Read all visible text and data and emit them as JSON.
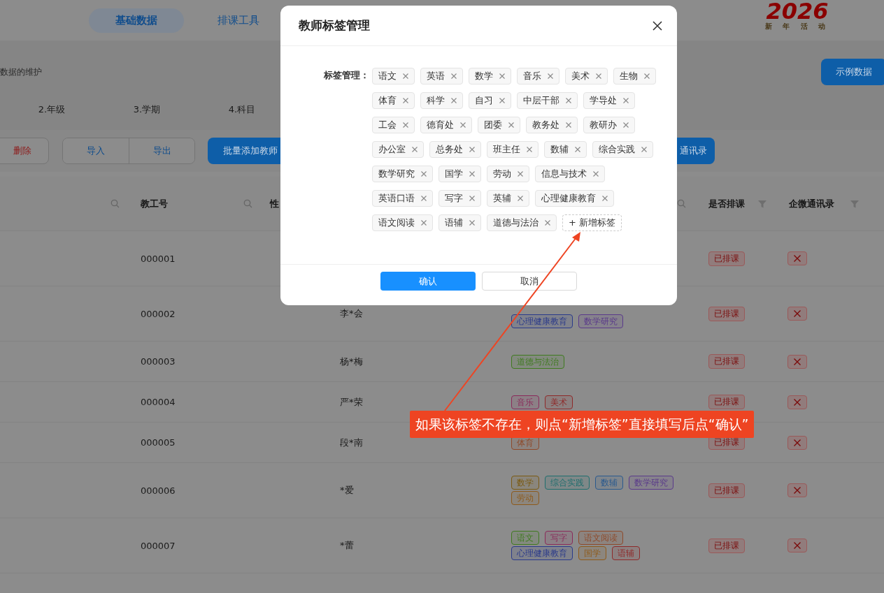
{
  "top_nav": {
    "tabs": [
      {
        "label": "基础数据",
        "selected": true
      },
      {
        "label": "排课工具",
        "selected": false
      }
    ],
    "logo": {
      "year": "2026",
      "caption": "新 年 活 动"
    }
  },
  "intro": {
    "description": "数据的维护",
    "sample_button": "示例数据",
    "steps": [
      "2.年级",
      "3.学期",
      "4.科目"
    ]
  },
  "toolbar": {
    "delete": "删除",
    "import": "导入",
    "export": "导出",
    "batch_add": "批量添加教师",
    "contacts": "通讯录"
  },
  "table": {
    "columns": [
      {
        "kind": "search"
      },
      {
        "label": "教工号",
        "kind": "search"
      },
      {
        "label": "性",
        "kind": "plain"
      },
      {
        "kind": "search"
      },
      {
        "label": "是否排课",
        "kind": "filter"
      },
      {
        "label": "企微通讯录",
        "kind": "filter"
      }
    ],
    "rows": [
      {
        "id": "000001",
        "scheduled": "已排课",
        "wecom": false
      },
      {
        "id": "000002",
        "name": "李*会",
        "tags": [
          {
            "label": "心理健康教育",
            "color": "#2a3a8a"
          },
          {
            "label": "数学研究",
            "color": "#5a3a8a"
          }
        ],
        "scheduled": "已排课",
        "wecom": false
      },
      {
        "id": "000003",
        "name": "杨*梅",
        "tags": [
          {
            "label": "道德与法治",
            "color": "#3f7a1f"
          }
        ],
        "scheduled": "已排课",
        "wecom": false
      },
      {
        "id": "000004",
        "name": "严*荣",
        "tags": [
          {
            "label": "音乐",
            "color": "#8a2a5a"
          },
          {
            "label": "美术",
            "color": "#8e2a2a"
          }
        ],
        "scheduled": "已排课",
        "wecom": false
      },
      {
        "id": "000005",
        "name": "段*南",
        "tags": [
          {
            "label": "体育",
            "color": "#8e4a2a"
          }
        ],
        "scheduled": "已排课",
        "wecom": false
      },
      {
        "id": "000006",
        "name": "*爱",
        "tags": [
          {
            "label": "数学",
            "color": "#7a5a12"
          },
          {
            "label": "综合实践",
            "color": "#1f6e6e"
          },
          {
            "label": "数辅",
            "color": "#2a5a8e"
          },
          {
            "label": "数学研究",
            "color": "#5a3a8a"
          },
          {
            "label": "劳动",
            "color": "#8e5a1a"
          }
        ],
        "scheduled": "已排课",
        "wecom": false
      },
      {
        "id": "000007",
        "name": "*蕾",
        "tags": [
          {
            "label": "语文",
            "color": "#3f7a1f"
          },
          {
            "label": "写字",
            "color": "#8a2a5a"
          },
          {
            "label": "语文阅读",
            "color": "#8e4a2a"
          },
          {
            "label": "心理健康教育",
            "color": "#2a3a8a"
          },
          {
            "label": "国学",
            "color": "#8e5a1a"
          },
          {
            "label": "语辅",
            "color": "#8e2a2a"
          }
        ],
        "scheduled": "已排课",
        "wecom": false
      }
    ]
  },
  "modal": {
    "title": "教师标签管理",
    "field_label": "标签管理：",
    "tags": [
      "语文",
      "英语",
      "数学",
      "音乐",
      "美术",
      "生物",
      "体育",
      "科学",
      "自习",
      "中层干部",
      "学导处",
      "工会",
      "德育处",
      "团委",
      "教务处",
      "教研办",
      "办公室",
      "总务处",
      "班主任",
      "数辅",
      "综合实践",
      "数学研究",
      "国学",
      "劳动",
      "信息与技术",
      "英语口语",
      "写字",
      "英辅",
      "心理健康教育",
      "语文阅读",
      "语辅",
      "道德与法治"
    ],
    "add_tag": "新增标签",
    "add_icon": "+",
    "confirm": "确认",
    "cancel": "取消"
  },
  "annotation": {
    "text": "如果该标签不存在，则点“新增标签”直接填写后点“确认”"
  }
}
